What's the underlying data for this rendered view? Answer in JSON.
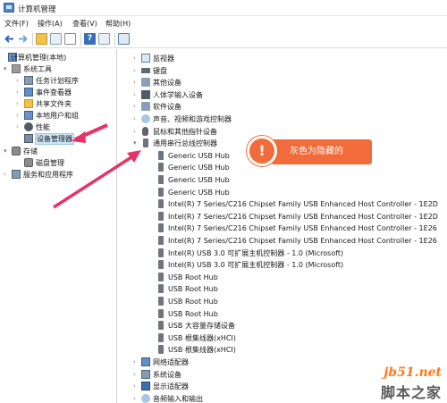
{
  "window": {
    "title": "计算机管理"
  },
  "menu": [
    "文件(F)",
    "操作(A)",
    "查看(V)",
    "帮助(H)"
  ],
  "left_tree": [
    {
      "label": "计算机管理(本地)",
      "icon": "computer-icon",
      "arrow": ""
    },
    {
      "label": "系统工具",
      "icon": "tools-icon",
      "arrow": "▾"
    },
    {
      "label": "任务计划程序",
      "icon": "clock-icon",
      "arrow": "›"
    },
    {
      "label": "事件查看器",
      "icon": "event-viewer-icon",
      "arrow": "›"
    },
    {
      "label": "共享文件夹",
      "icon": "folder-icon",
      "arrow": "›"
    },
    {
      "label": "本地用户和组",
      "icon": "users-icon",
      "arrow": "›"
    },
    {
      "label": "性能",
      "icon": "performance-icon",
      "arrow": "›"
    },
    {
      "label": "设备管理器",
      "icon": "device-manager-icon",
      "arrow": ""
    },
    {
      "label": "存储",
      "icon": "storage-icon",
      "arrow": "▾"
    },
    {
      "label": "磁盘管理",
      "icon": "disk-icon",
      "arrow": ""
    },
    {
      "label": "服务和应用程序",
      "icon": "services-icon",
      "arrow": "›"
    }
  ],
  "right_tree": [
    {
      "label": "监视器",
      "icon": "monitor-icon",
      "arrow": "›"
    },
    {
      "label": "键盘",
      "icon": "keyboard-icon",
      "arrow": "›"
    },
    {
      "label": "其他设备",
      "icon": "other-device-icon",
      "arrow": "›"
    },
    {
      "label": "人体学输入设备",
      "icon": "hid-icon",
      "arrow": "›"
    },
    {
      "label": "软件设备",
      "icon": "software-device-icon",
      "arrow": "›"
    },
    {
      "label": "声音、视频和游戏控制器",
      "icon": "audio-icon",
      "arrow": "›"
    },
    {
      "label": "鼠标和其他指针设备",
      "icon": "mouse-icon",
      "arrow": "›"
    },
    {
      "label": "通用串行总线控制器",
      "icon": "usb-icon",
      "arrow": "▾"
    },
    {
      "label": "Generic USB Hub",
      "icon": "usb-device-icon",
      "arrow": ""
    },
    {
      "label": "Generic USB Hub",
      "icon": "usb-device-icon",
      "arrow": ""
    },
    {
      "label": "Generic USB Hub",
      "icon": "usb-device-icon",
      "arrow": ""
    },
    {
      "label": "Generic USB Hub",
      "icon": "usb-device-icon",
      "arrow": ""
    },
    {
      "label": "Intel(R) 7 Series/C216 Chipset Family USB Enhanced Host Controller - 1E2D",
      "icon": "usb-device-icon",
      "arrow": ""
    },
    {
      "label": "Intel(R) 7 Series/C216 Chipset Family USB Enhanced Host Controller - 1E2D",
      "icon": "usb-device-icon",
      "arrow": ""
    },
    {
      "label": "Intel(R) 7 Series/C216 Chipset Family USB Enhanced Host Controller - 1E26",
      "icon": "usb-device-icon",
      "arrow": ""
    },
    {
      "label": "Intel(R) 7 Series/C216 Chipset Family USB Enhanced Host Controller - 1E26",
      "icon": "usb-device-icon",
      "arrow": ""
    },
    {
      "label": "Intel(R) USB 3.0 可扩展主机控制器 - 1.0 (Microsoft)",
      "icon": "usb-device-icon",
      "arrow": ""
    },
    {
      "label": "Intel(R) USB 3.0 可扩展主机控制器 - 1.0 (Microsoft)",
      "icon": "usb-device-icon",
      "arrow": ""
    },
    {
      "label": "USB Root Hub",
      "icon": "usb-device-icon",
      "arrow": ""
    },
    {
      "label": "USB Root Hub",
      "icon": "usb-device-icon",
      "arrow": ""
    },
    {
      "label": "USB Root Hub",
      "icon": "usb-device-icon",
      "arrow": ""
    },
    {
      "label": "USB Root Hub",
      "icon": "usb-device-icon",
      "arrow": ""
    },
    {
      "label": "USB 大容量存储设备",
      "icon": "usb-device-icon",
      "arrow": ""
    },
    {
      "label": "USB 根集线器(xHCI)",
      "icon": "usb-device-icon",
      "arrow": ""
    },
    {
      "label": "USB 根集线器(xHCI)",
      "icon": "usb-device-icon",
      "arrow": ""
    },
    {
      "label": "网络适配器",
      "icon": "network-icon",
      "arrow": "›"
    },
    {
      "label": "系统设备",
      "icon": "system-device-icon",
      "arrow": "›"
    },
    {
      "label": "显示适配器",
      "icon": "display-icon",
      "arrow": "›"
    },
    {
      "label": "音频输入和输出",
      "icon": "audio-io-icon",
      "arrow": "›"
    }
  ],
  "callout": {
    "text": "灰色为隐藏的",
    "icon": "exclamation-icon"
  },
  "watermark": {
    "url": "jb51.net",
    "name": "脚本之家"
  },
  "colors": {
    "accent": "#f26b3a",
    "arrow": "#e8326a",
    "selection": "#cce4f7"
  }
}
